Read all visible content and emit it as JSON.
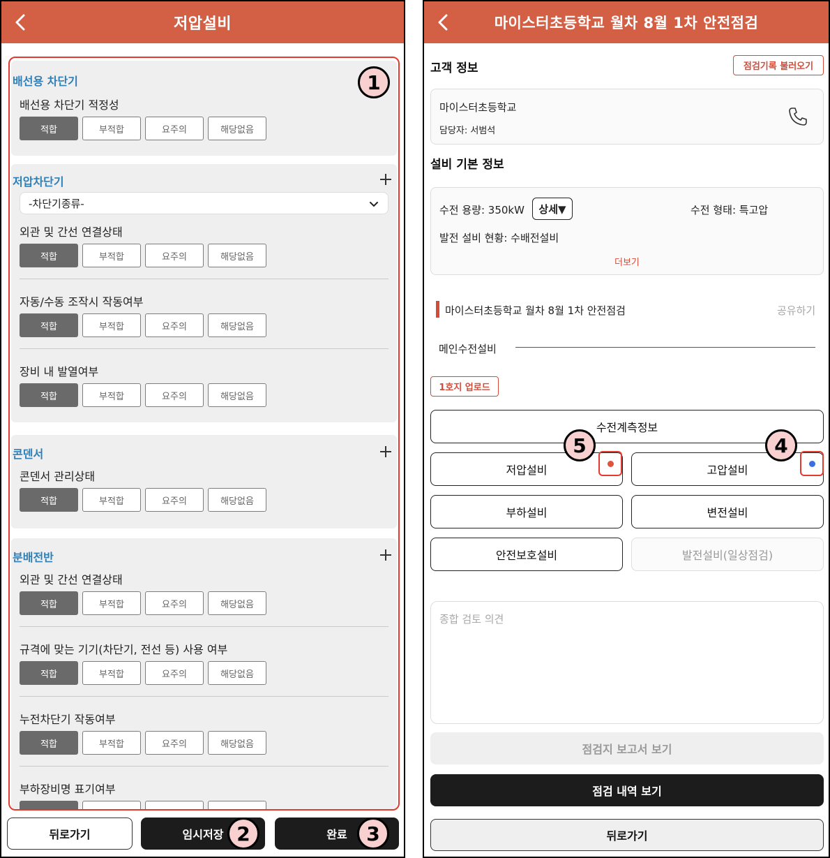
{
  "left": {
    "title": "저압설비",
    "sections": [
      {
        "title": "배선용 차단기",
        "items": [
          "배선용 차단기 적정성"
        ]
      },
      {
        "title": "저압차단기",
        "select_value": "-차단기종류-",
        "items": [
          "외관 및 간선 연결상태",
          "자동/수동 조작시 작동여부",
          "장비 내 발열여부"
        ]
      },
      {
        "title": "콘덴서",
        "items": [
          "콘덴서 관리상태"
        ]
      },
      {
        "title": "분배전반",
        "items": [
          "외관 및 간선 연결상태",
          "규격에 맞는 기기(차단기, 전선 등) 사용 여부",
          "누전차단기 작동여부",
          "부하장비명 표기여부"
        ]
      }
    ],
    "options": [
      "적합",
      "부적합",
      "요주의",
      "해당없음"
    ],
    "selected_option": "적합",
    "footer": {
      "back": "뒤로가기",
      "save": "임시저장",
      "done": "완료"
    },
    "badges": [
      "1",
      "2",
      "3"
    ]
  },
  "right": {
    "title": "마이스터초등학교 월차 8월 1차 안전점검",
    "customer_heading": "고객 정보",
    "load_record": "점검기록 불러오기",
    "customer_name": "마이스터초등학교",
    "manager": "담당자: 서범석",
    "equip_heading": "설비 기본 정보",
    "capacity": "수전 용량: 350kW",
    "detail_btn": "상세▼",
    "receive_type": "수전 형태: 특고압",
    "generation": "발전 설비 현황: 수배전설비",
    "more": "더보기",
    "inspection_title": "마이스터초등학교 월차 8월 1차 안전점검",
    "share": "공유하기",
    "main_label": "메인수전설비",
    "upload": "1호지 업로드",
    "meter_btn": "수전계측정보",
    "equipment": [
      "저압설비",
      "고압설비",
      "부하설비",
      "변전설비",
      "안전보호설비",
      "발전설비(일상점검)"
    ],
    "status_colors": {
      "low_voltage": "#e0533f",
      "high_voltage": "#3a6fe0"
    },
    "comment_placeholder": "종합 검토 의견",
    "report_btn": "점검지 보고서 보기",
    "history_btn": "점검 내역 보기",
    "back_btn": "뒤로가기",
    "badges": [
      "4",
      "5"
    ]
  }
}
